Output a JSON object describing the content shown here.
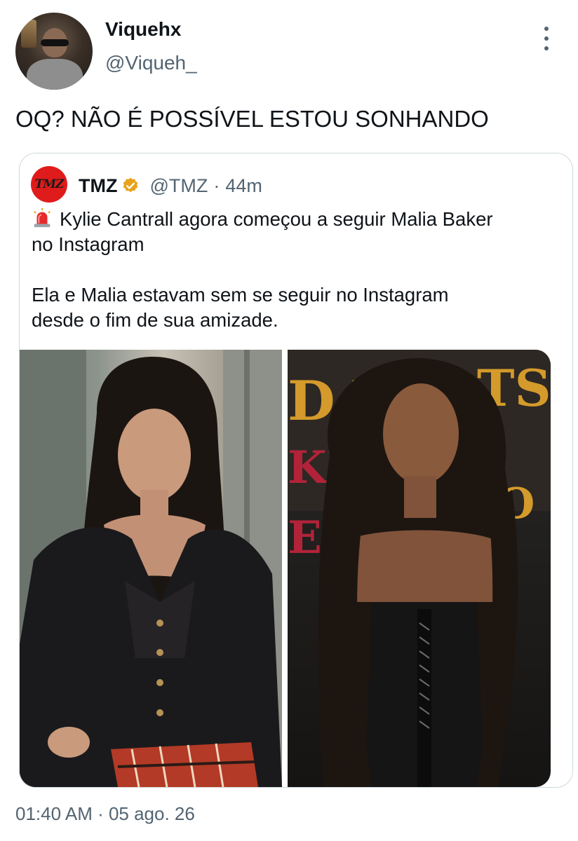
{
  "author": {
    "display_name": "Viquehx",
    "handle": "@Viqueh_",
    "avatar_icon": "user-avatar"
  },
  "more_icon": "more-vertical-icon",
  "tweet_text": "OQ? NÃO É POSSÍVEL ESTOU SONHANDO",
  "quote": {
    "logo_text": "TMZ",
    "logo_color": "#e01b1b",
    "name": "TMZ",
    "verified_icon": "verified-badge-icon",
    "verified_color": "#e8a21b",
    "handle": "@TMZ",
    "separator": "·",
    "time": "44m",
    "siren_icon": "police-siren-icon",
    "lines": [
      "Kylie Cantrall agora começou a seguir Malia Baker",
      "no Instagram",
      "Ela e Malia estavam sem se seguir no Instagram",
      "desde o fim de sua amizade."
    ],
    "photos": [
      {
        "name": "photo-kylie-cantrall",
        "description_icon": "photo-icon"
      },
      {
        "name": "photo-malia-baker",
        "description_icon": "photo-icon"
      }
    ]
  },
  "timestamp": "01:40 AM · 05 ago. 26",
  "colors": {
    "text": "#0f1419",
    "secondary": "#536471",
    "border": "#cfd9de"
  }
}
